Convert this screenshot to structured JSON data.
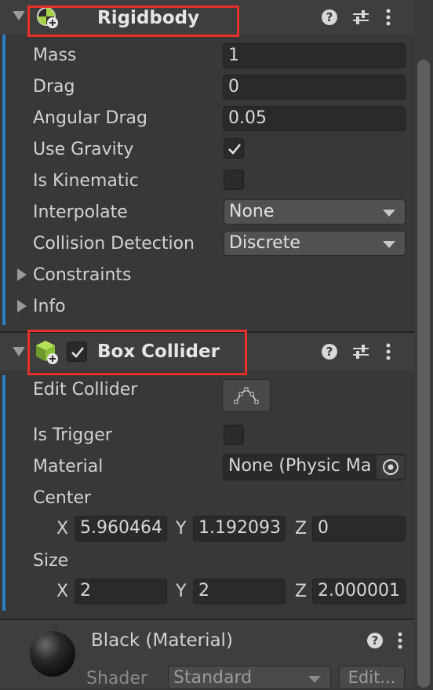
{
  "rigidbody": {
    "title": "Rigidbody",
    "icon": "rigidbody-icon",
    "rows": {
      "mass": {
        "label": "Mass",
        "value": "1"
      },
      "drag": {
        "label": "Drag",
        "value": "0"
      },
      "angular_drag": {
        "label": "Angular Drag",
        "value": "0.05"
      },
      "use_gravity": {
        "label": "Use Gravity",
        "checked": true
      },
      "is_kinematic": {
        "label": "Is Kinematic",
        "checked": false
      },
      "interpolate": {
        "label": "Interpolate",
        "value": "None"
      },
      "collision_detection": {
        "label": "Collision Detection",
        "value": "Discrete"
      }
    },
    "foldouts": {
      "constraints": "Constraints",
      "info": "Info"
    }
  },
  "box_collider": {
    "title": "Box Collider",
    "enabled": true,
    "icon": "box-collider-icon",
    "edit_collider_label": "Edit Collider",
    "is_trigger": {
      "label": "Is Trigger",
      "checked": false
    },
    "material": {
      "label": "Material",
      "value": "None (Physic Ma"
    },
    "center": {
      "label": "Center",
      "x_label": "X",
      "x": "5.960464",
      "y_label": "Y",
      "y": "1.192093",
      "z_label": "Z",
      "z": "0"
    },
    "size": {
      "label": "Size",
      "x_label": "X",
      "x": "2",
      "y_label": "Y",
      "y": "2",
      "z_label": "Z",
      "z": "2.000001"
    }
  },
  "material": {
    "title": "Black (Material)",
    "shader_label": "Shader",
    "shader_value": "Standard",
    "edit_button": "Edit..."
  },
  "colors": {
    "accent": "#2d7ec9",
    "highlight": "#e8302a",
    "panel": "#383838"
  }
}
